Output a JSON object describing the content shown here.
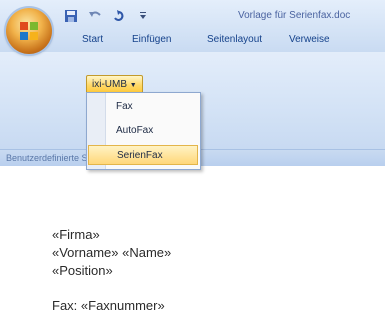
{
  "title_bar": {
    "document_title": "Vorlage für Serienfax.doc"
  },
  "quick_access": {
    "icons": [
      "save-icon",
      "undo-icon",
      "redo-icon",
      "customize-icon"
    ]
  },
  "ribbon": {
    "tabs": [
      {
        "label": "Start"
      },
      {
        "label": "Einfügen"
      },
      {
        "label": "Seitenlayout"
      },
      {
        "label": "Verweise"
      }
    ],
    "group_label": "Benutzerdefinierte Symbolleisten",
    "dropdown_label": "ixi-UMB"
  },
  "menu": {
    "items": [
      {
        "label": "Fax",
        "selected": false
      },
      {
        "label": "AutoFax",
        "selected": false
      },
      {
        "label": "SerienFax",
        "selected": true
      }
    ]
  },
  "document": {
    "lines": [
      "«Firma»",
      "«Vorname» «Name»",
      "«Position»",
      "Fax: «Faxnummer»"
    ]
  },
  "colors": {
    "ribbon_bg": "#d4e3f6",
    "tab_text": "#15428b",
    "highlight": "#ffd77a"
  }
}
